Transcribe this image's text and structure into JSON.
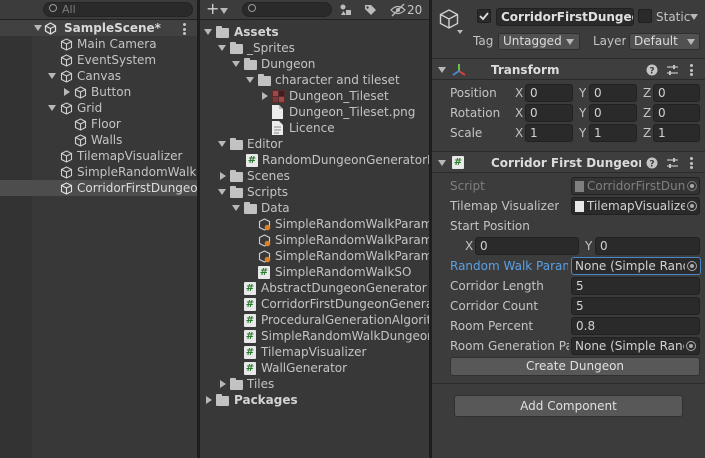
{
  "hierarchy": {
    "search_placeholder": "All",
    "scene_name": "SampleScene*",
    "items": [
      {
        "label": "Main Camera"
      },
      {
        "label": "EventSystem"
      },
      {
        "label": "Canvas"
      },
      {
        "label": "Button"
      },
      {
        "label": "Grid"
      },
      {
        "label": "Floor"
      },
      {
        "label": "Walls"
      },
      {
        "label": "TilemapVisualizer"
      },
      {
        "label": "SimpleRandomWalkD"
      },
      {
        "label": "CorridorFirstDungeon"
      }
    ]
  },
  "project": {
    "hidden_count": "20",
    "tree": [
      {
        "label": "Assets"
      },
      {
        "label": "_Sprites"
      },
      {
        "label": "Dungeon"
      },
      {
        "label": "character and tileset"
      },
      {
        "label": "Dungeon_Tileset"
      },
      {
        "label": "Dungeon_Tileset.png"
      },
      {
        "label": "Licence"
      },
      {
        "label": "Editor"
      },
      {
        "label": "RandomDungeonGeneratorEd"
      },
      {
        "label": "Scenes"
      },
      {
        "label": "Scripts"
      },
      {
        "label": "Data"
      },
      {
        "label": "SimpleRandomWalkParame"
      },
      {
        "label": "SimpleRandomWalkParame"
      },
      {
        "label": "SimpleRandomWalkParame"
      },
      {
        "label": "SimpleRandomWalkSO"
      },
      {
        "label": "AbstractDungeonGenerator"
      },
      {
        "label": "CorridorFirstDungeonGenerato"
      },
      {
        "label": "ProceduralGenerationAlgorith"
      },
      {
        "label": "SimpleRandomWalkDungeonG"
      },
      {
        "label": "TilemapVisualizer"
      },
      {
        "label": "WallGenerator"
      },
      {
        "label": "Tiles"
      },
      {
        "label": "Packages"
      }
    ]
  },
  "inspector": {
    "object_name": "CorridorFirstDungeonG",
    "static_label": "Static",
    "tag_label": "Tag",
    "tag_value": "Untagged",
    "layer_label": "Layer",
    "layer_value": "Default",
    "transform": {
      "title": "Transform",
      "rows": [
        {
          "label": "Position",
          "x": "0",
          "y": "0",
          "z": "0"
        },
        {
          "label": "Rotation",
          "x": "0",
          "y": "0",
          "z": "0"
        },
        {
          "label": "Scale",
          "x": "1",
          "y": "1",
          "z": "1"
        }
      ],
      "x_letter": "X",
      "y_letter": "Y",
      "z_letter": "Z"
    },
    "component": {
      "title": "Corridor First Dungeon Ge",
      "script_label": "Script",
      "script_value": "CorridorFirstDung",
      "tilemap_label": "Tilemap Visualizer",
      "tilemap_value": "TilemapVisualize",
      "start_label": "Start Position",
      "start_x_letter": "X",
      "start_x": "0",
      "start_y_letter": "Y",
      "start_y": "0",
      "random_walk_label": "Random Walk Parame",
      "random_walk_value": "None (Simple Rand",
      "corridor_length_label": "Corridor Length",
      "corridor_length": "5",
      "corridor_count_label": "Corridor Count",
      "corridor_count": "5",
      "room_percent_label": "Room Percent",
      "room_percent": "0.8",
      "room_gen_label": "Room Generation Par",
      "room_gen_value": "None (Simple Rand",
      "create_button": "Create Dungeon"
    },
    "add_component": "Add Component"
  },
  "colors": {
    "panel_bg": "#383838",
    "selection": "#2c5d87",
    "highlight_label": "#5aa0e6"
  }
}
